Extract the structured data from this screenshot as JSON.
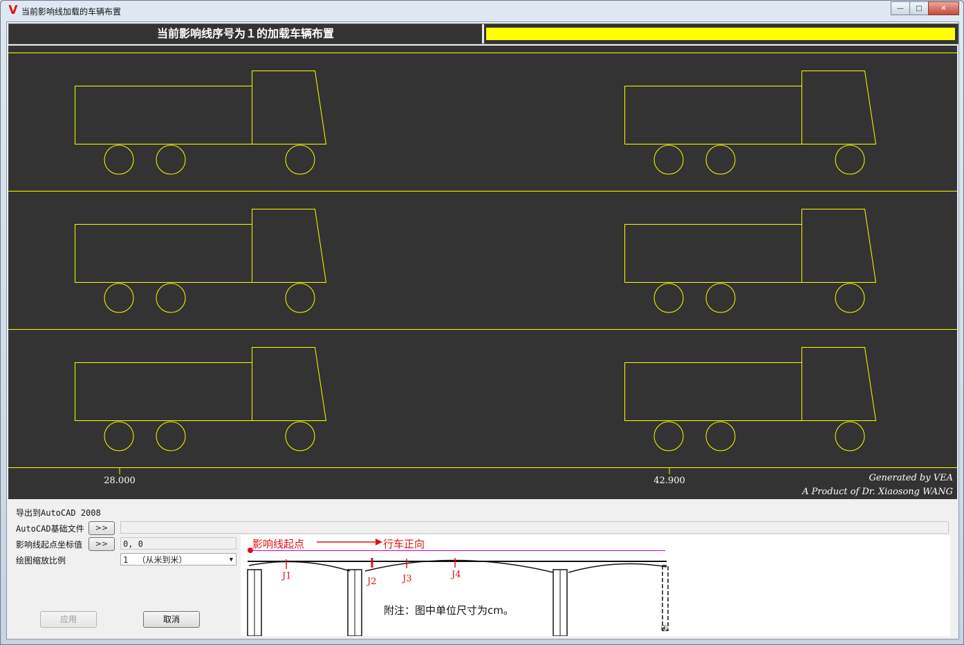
{
  "window": {
    "title": "当前影响线加载的车辆布置",
    "icon_letter": "V"
  },
  "header": {
    "title": "当前影响线序号为１的加载车辆布置",
    "progress_fraction": 1.0,
    "progress_color": "#ffff00"
  },
  "canvas": {
    "background": "#333333",
    "line_color": "#ffff00",
    "lanes": 3,
    "vehicle_positions": [
      "28.000",
      "42.900"
    ],
    "credit_line1": "Generated by VEA",
    "credit_line2": "A Product of Dr. Xiaosong WANG"
  },
  "export": {
    "section_title": "导出到AutoCAD 2008",
    "base_file_label": "AutoCAD基础文件",
    "base_file_value": "",
    "origin_label": "影响线起点坐标值",
    "origin_value": "0, 0",
    "scale_label": "绘图缩放比例",
    "scale_value": "1 　（从米到米）",
    "browse_label": ">>",
    "apply_label": "应用",
    "cancel_label": "取消"
  },
  "diagram": {
    "start_label": "影响线起点",
    "direction_label": "行车正向",
    "points": [
      "J1",
      "J2",
      "J3",
      "J4"
    ],
    "note": "附注：图中单位尺寸为cm。",
    "pier_mark": "④"
  }
}
